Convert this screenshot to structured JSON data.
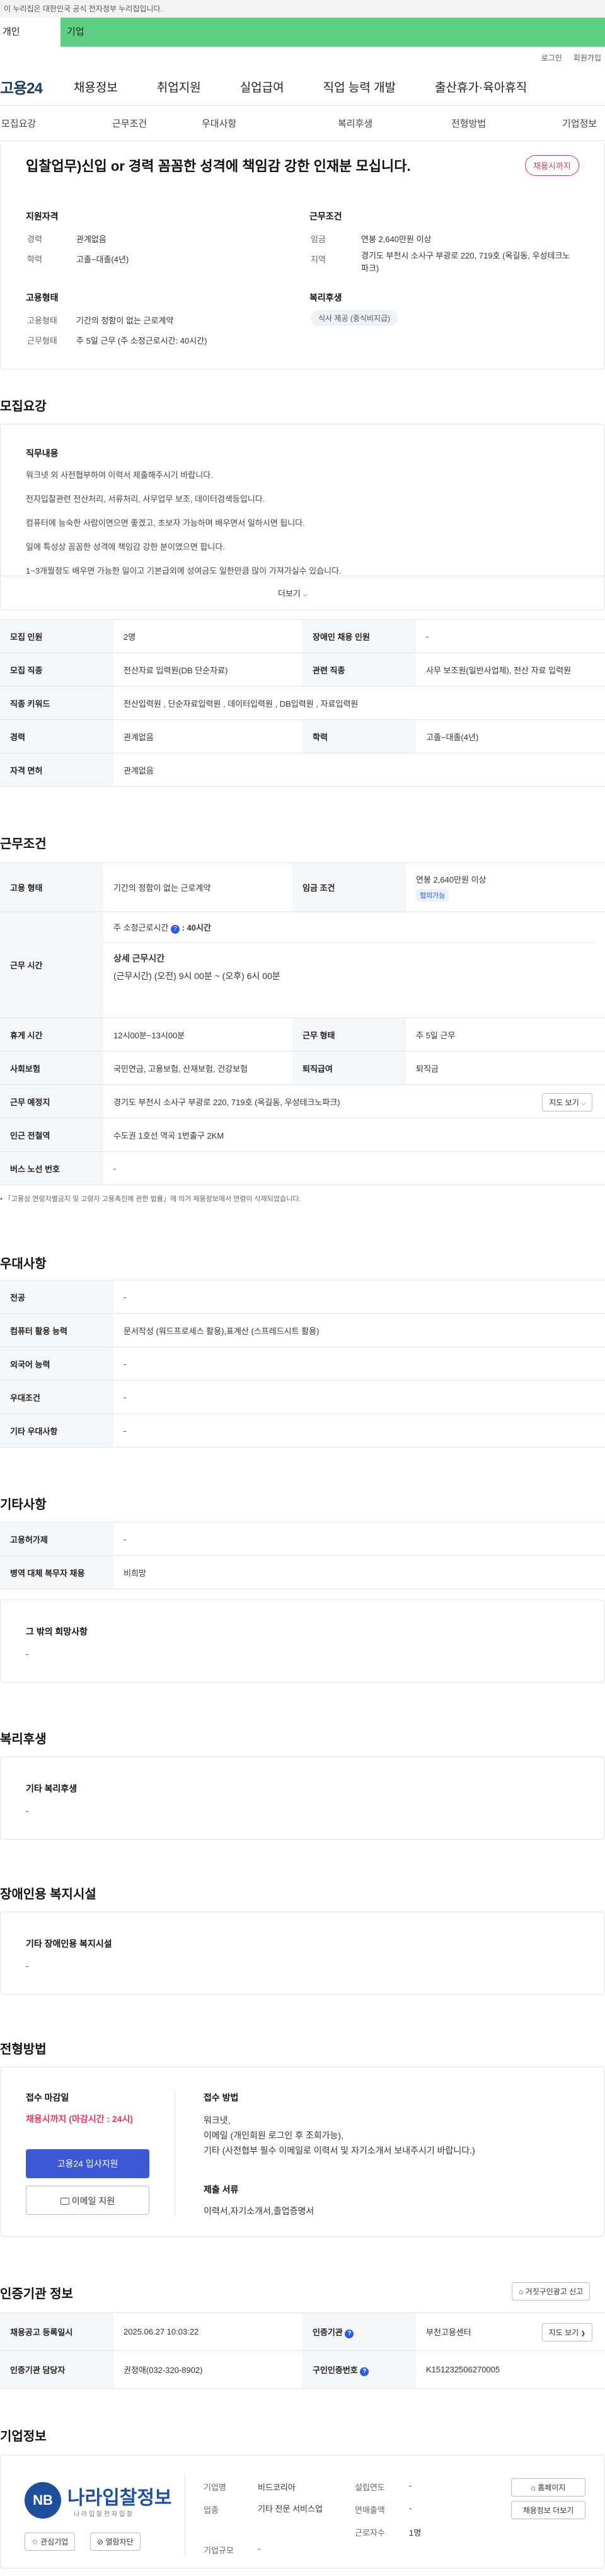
{
  "gov_banner": "이 누리집은 대한민국 공식 전자정부 누리집입니다.",
  "top_tabs": {
    "individual": "개인",
    "company": "기업"
  },
  "utility": {
    "login": "로그인",
    "join": "회원가입"
  },
  "gnb": {
    "logo": "고용24",
    "items": [
      "채용정보",
      "취업지원",
      "실업급여",
      "직업 능력 개발",
      "출산휴가·육아휴직"
    ]
  },
  "subnav": [
    "모집요강",
    "근무조건",
    "우대사항",
    "복리후생",
    "전형방법",
    "기업정보"
  ],
  "summary": {
    "title": "입찰업무)신입 or 경력 꼼꼼한 성격에 책임감 강한 인재분 모십니다.",
    "badge": "채용시까지",
    "qual_title": "지원자격",
    "career_k": "경력",
    "career_v": "관계없음",
    "edu_k": "학력",
    "edu_v": "고졸~대졸(4년)",
    "cond_title": "근무조건",
    "wage_k": "임금",
    "wage_v": "연봉 2,640만원 이상",
    "region_k": "지역",
    "region_v": "경기도 부천시 소사구 부광로 220, 719호 (옥길동, 우성테크노파크)",
    "emp_title": "고용형태",
    "emptype_k": "고용형태",
    "emptype_v": "기간의 정함이 없는 근로계약",
    "worktype_k": "근무형태",
    "worktype_v": "주 5일 근무 (주 소정근로시간: 40시간)",
    "welfare_title": "복리후생",
    "welfare_pill": "식사 제공 (중식비지급)"
  },
  "recruit": {
    "title": "모집요강",
    "duty_title": "직무내용",
    "duty_lines": [
      "워크넷 외 사전협부하여 이력서 제출해주시기 바랍니다.",
      "전자입찰관련 전산처리, 서류처리, 사무업무 보조, 데이터검색등입니다.",
      "컴퓨터에 능숙한 사람이면으면 좋겠고, 초보자 가능하며 배우면서 일하시면 됩니다.",
      "일에 특성상 꼼꼼한 성격에 책임감 강한 분이였으면 합니다.",
      "1~3개월정도 배우면 가능한 일이고 기본급외에 성여금도 일한만큼 많이 가져가실수 있습니다."
    ],
    "more": "더보기",
    "rows": [
      {
        "k1": "모집 인원",
        "v1": "2명",
        "k2": "장애인 채용 인원",
        "v2": "-"
      },
      {
        "k1": "모집 직종",
        "v1": "전산자료 입력원(DB 단순자료)",
        "k2": "관련 직종",
        "v2": "사무 보조원(일반사업체), 전산 자료 입력원"
      },
      {
        "k1": "직종 키워드",
        "v1": "전산입력원 , 단순자료입력원 , 데이터입력원 , DB입력원 , 자료입력원",
        "k2": "",
        "v2": ""
      },
      {
        "k1": "경력",
        "v1": "관계없음",
        "k2": "학력",
        "v2": "고졸~대졸(4년)"
      },
      {
        "k1": "자격 면허",
        "v1": "관계없음",
        "k2": "",
        "v2": ""
      }
    ]
  },
  "work": {
    "title": "근무조건",
    "emp_k": "고용 형태",
    "emp_v": "기간의 정함이 없는 근로계약",
    "wage_k": "임금 조건",
    "wage_v": "연봉 2,640만원 이상",
    "wage_tag": "협의가능",
    "time_k": "근무 시간",
    "time_weekly": "주 소정근로시간",
    "time_weekly_v": ": 40시간",
    "time_detail_title": "상세 근무시간",
    "time_detail": "(근무시간) (오전) 9시 00분 ~ (오후) 6시 00분",
    "rest_k": "휴게 시간",
    "rest_v": "12시00분~13시00분",
    "form_k": "근무 형태",
    "form_v": "주 5일 근무",
    "insure_k": "사회보험",
    "insure_v": "국민연금, 고용보험, 산재보험, 건강보험",
    "retire_k": "퇴직급여",
    "retire_v": "퇴직금",
    "place_k": "근무 예정지",
    "place_v": "경기도 부천시 소사구 부광로 220, 719호 (옥길동, 우성테크노파크)",
    "map_btn": "지도 보기",
    "station_k": "인근 전철역",
    "station_v": "수도권 1호선 역곡 1번출구 2KM",
    "bus_k": "버스 노선 번호",
    "bus_v": "-",
    "note": "「고용상 연령차별금지 및 고령자 고용촉진에 관한 법률」에 의거 채용정보에서 연령이 삭제되었습니다."
  },
  "pref": {
    "title": "우대사항",
    "rows": [
      {
        "k": "전공",
        "v": "-"
      },
      {
        "k": "컴퓨터 활용 능력",
        "v": "문서작성 (워드프로세스 활용),표계산 (스프레드시트 활용)"
      },
      {
        "k": "외국어 능력",
        "v": "-"
      },
      {
        "k": "우대조건",
        "v": "-"
      },
      {
        "k": "기타 우대사항",
        "v": "-"
      }
    ]
  },
  "etc": {
    "title": "기타사항",
    "rows": [
      {
        "k": "고용허가제",
        "v": "-"
      },
      {
        "k": "병역 대체 복무자 채용",
        "v": "비희망"
      }
    ],
    "other_title": "그 밖의 희망사항",
    "other_v": "-"
  },
  "benefit": {
    "title": "복리후생",
    "box_title": "기타 복리후생",
    "box_v": "-"
  },
  "disabled": {
    "title": "장애인용 복지시설",
    "box_title": "기타 장애인용 복지시설",
    "box_v": "-"
  },
  "screen": {
    "title": "전형방법",
    "deadline_title": "접수 마감일",
    "deadline_v": "채용시까지 (마감시간 : 24시)",
    "apply_btn": "고용24 입사지원",
    "email_btn": "이메일 지원",
    "method_title": "접수 방법",
    "method_lines": [
      "워크넷,",
      "이메일 (개인회원 로그인 후 조회가능),",
      "기타 (사전협부 필수 이메일로 이력서 및 자기소개서 보내주시기 바랍니다.)"
    ],
    "docs_title": "제출 서류",
    "docs_v": "이력서,자기소개서,졸업증명서"
  },
  "cert": {
    "title": "인증기관 정보",
    "report_btn": "거짓구인광고 신고",
    "reg_k": "채용공고 등록일시",
    "reg_v": "2025.06.27 10:03:22",
    "org_k": "인증기관",
    "org_v": "부천고용센터",
    "map_btn": "지도 보기",
    "manager_k": "인증기관 담당자",
    "manager_v": "권정애(032-320-8902)",
    "num_k": "구인인증번호",
    "num_v": "K151232506270005"
  },
  "company": {
    "title": "기업정보",
    "logo_initials": "NB",
    "logo_name": "나라입찰정보",
    "logo_sub": "나 라 입 찰 전 자 입 찰",
    "fav_btn": "관심기업",
    "block_btn": "열람차단",
    "name_k": "기업명",
    "name_v": "비드코리아",
    "industry_k": "업종",
    "industry_v": "기타 전문 서비스업",
    "size_k": "기업규모",
    "size_v": "-",
    "founded_k": "설립연도",
    "founded_v": "-",
    "sales_k": "연매출액",
    "sales_v": "-",
    "workers_k": "근로자수",
    "workers_v": "1명",
    "homepage_btn": "홈페이지",
    "other_jobs_btn": "채용정보 더보기"
  }
}
